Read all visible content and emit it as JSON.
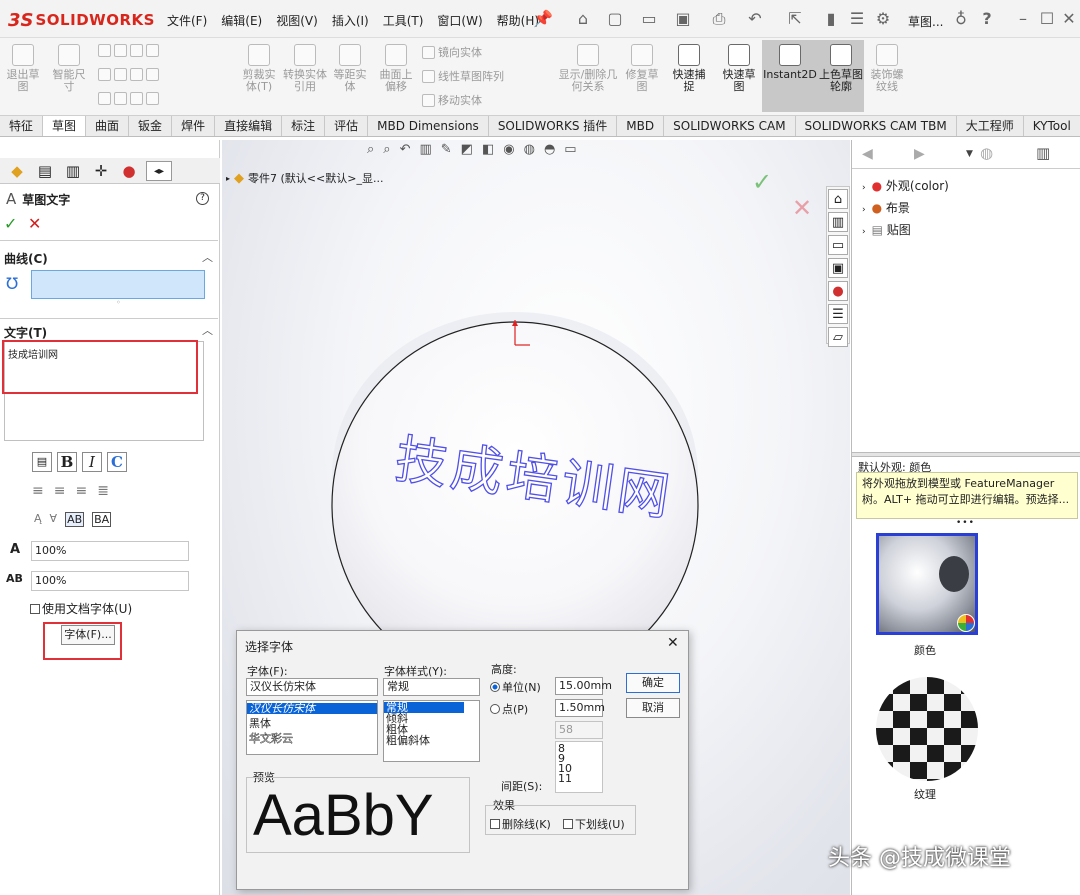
{
  "app": {
    "logo_prefix": "3S",
    "logo_text": "SOLIDWORKS"
  },
  "menu": [
    "文件(F)",
    "编辑(E)",
    "视图(V)",
    "插入(I)",
    "工具(T)",
    "窗口(W)",
    "帮助(H)"
  ],
  "titlebar": {
    "doc_label": "草图...",
    "help": "?",
    "minimize": "–",
    "maximize": "☐",
    "close": "✕"
  },
  "ribbon": {
    "exit_sketch": "退出草图",
    "smart_dim": "智能尺寸",
    "trim": "剪裁实体(T)",
    "convert": "转换实体引用",
    "offset": "等距实体",
    "surface_offset": "曲面上偏移",
    "mirror": "镜向实体",
    "linear_pattern": "线性草图阵列",
    "move": "移动实体",
    "display_relations": "显示/删除几何关系",
    "repair": "修复草图",
    "quick_snap": "快速捕捉",
    "rapid_sketch": "快速草图",
    "instant2d": "Instant2D",
    "shaded_contours": "上色草图轮廓",
    "cosmetic_thread": "装饰螺纹线"
  },
  "tabs": [
    "特征",
    "草图",
    "曲面",
    "钣金",
    "焊件",
    "直接编辑",
    "标注",
    "评估",
    "MBD Dimensions",
    "SOLIDWORKS 插件",
    "MBD",
    "SOLIDWORKS CAM",
    "SOLIDWORKS CAM TBM",
    "大工程师",
    "KYTool"
  ],
  "property_manager": {
    "title": "草图文字",
    "help_icon": "?",
    "ok": "✓",
    "cancel": "✕",
    "curves_section": "曲线(C)",
    "text_section": "文字(T)",
    "text_value": "技成培训网",
    "width_factor": "100%",
    "spacing": "100%",
    "use_doc_font": "使用文档字体(U)",
    "font_button": "字体(F)..."
  },
  "viewport": {
    "breadcrumb": "零件7 (默认<<默认>_显...",
    "sketch_text": "技成培训网"
  },
  "task_pane": {
    "tree": [
      {
        "label": "外观(color)"
      },
      {
        "label": "布景"
      },
      {
        "label": "贴图"
      }
    ],
    "tooltip_title": "默认外观: 颜色",
    "tooltip_body": "将外观拖放到模型或 FeatureManager 树。ALT+ 拖动可立即进行编辑。预选择...",
    "swatches": [
      {
        "label": "颜色"
      },
      {
        "label": "纹理"
      }
    ]
  },
  "font_dialog": {
    "title": "选择字体",
    "close": "✕",
    "font_label": "字体(F):",
    "font_value": "汉仪长仿宋体",
    "font_list": [
      "汉仪长仿宋体",
      "黑体",
      "华文彩云"
    ],
    "style_label": "字体样式(Y):",
    "style_value": "常规",
    "style_list": [
      "常规",
      "倾斜",
      "粗体",
      "粗偏斜体"
    ],
    "height_label": "高度:",
    "units_label": "单位(N)",
    "units_value": "15.00mm",
    "points_label": "点(P)",
    "points_value": "1.50mm",
    "size_value": "58",
    "size_list": [
      "8",
      "9",
      "10",
      "11"
    ],
    "spacing_label": "间距(S):",
    "ok": "确定",
    "cancel": "取消",
    "preview_label": "预览",
    "preview_text": "AaBbY",
    "effects_label": "效果",
    "strikeout": "删除线(K)",
    "underline": "下划线(U)"
  },
  "watermark": "头条 @技成微课堂",
  "colors": {
    "accent_blue": "#0a64d8",
    "sketch_text": "#5050e8",
    "highlight_red": "#e0303a",
    "tooltip_bg": "#ffffd0"
  }
}
